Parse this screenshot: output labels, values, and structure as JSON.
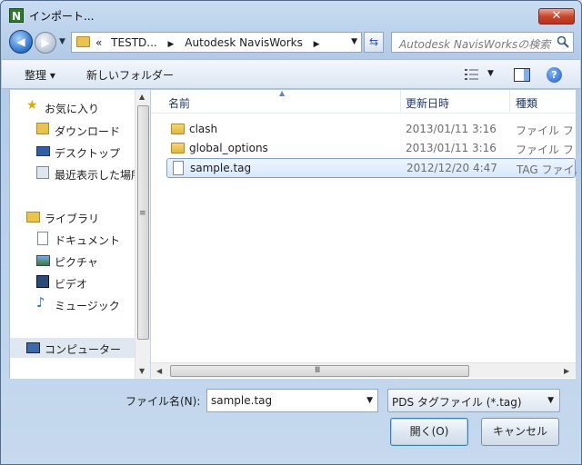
{
  "window": {
    "title": "インポート...",
    "close_label": "✕"
  },
  "address": {
    "segments": [
      "«",
      "TESTD...",
      "Autodesk NavisWorks"
    ],
    "search_placeholder": "Autodesk NavisWorksの検索"
  },
  "toolbar": {
    "organize": "整理 ▾",
    "new_folder": "新しいフォルダー"
  },
  "nav": {
    "favorites": "お気に入り",
    "downloads": "ダウンロード",
    "desktop": "デスクトップ",
    "recent": "最近表示した場所",
    "libraries": "ライブラリ",
    "documents": "ドキュメント",
    "pictures": "ピクチャ",
    "videos": "ビデオ",
    "music": "ミュージック",
    "computer": "コンピューター"
  },
  "columns": {
    "name": "名前",
    "date": "更新日時",
    "type": "種類"
  },
  "files": [
    {
      "name": "clash",
      "date": "2013/01/11 3:16",
      "type": "ファイル フォルダー",
      "kind": "folder"
    },
    {
      "name": "global_options",
      "date": "2013/01/11 3:16",
      "type": "ファイル フォルダー",
      "kind": "folder"
    },
    {
      "name": "sample.tag",
      "date": "2012/12/20 4:47",
      "type": "TAG ファイル",
      "kind": "file"
    }
  ],
  "bottom": {
    "filename_label": "ファイル名(N):",
    "filename_value": "sample.tag",
    "filter_value": "PDS タグファイル (*.tag)",
    "open_label": "開く(O)",
    "cancel_label": "キャンセル"
  }
}
